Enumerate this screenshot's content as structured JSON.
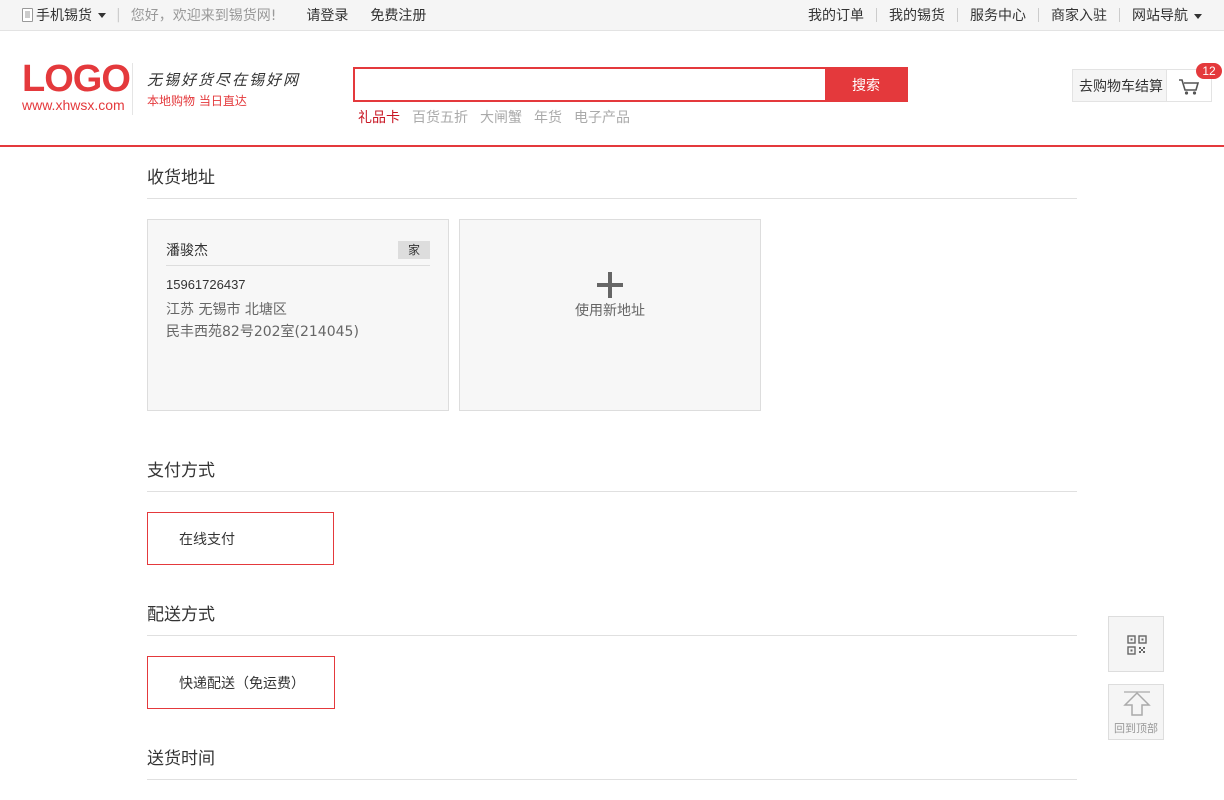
{
  "topbar": {
    "mobile": "手机锡货",
    "welcome": "您好，欢迎来到锡货网!",
    "login": "请登录",
    "register": "免费注册",
    "links": [
      "我的订单",
      "我的锡货",
      "服务中心",
      "商家入驻",
      "网站导航"
    ]
  },
  "header": {
    "logo_text": "LOGO",
    "logo_url": "www.xhwsx.com",
    "slogan": "无锡好货尽在锡好网",
    "slogan_sub": "本地购物  当日直达",
    "search_value": "",
    "search_button": "搜索",
    "hotwords": [
      "礼品卡",
      "百货五折",
      "大闸蟹",
      "年货",
      "电子产品"
    ],
    "cart_label": "去购物车结算",
    "cart_count": "12"
  },
  "address": {
    "title": "收货地址",
    "card": {
      "name": "潘骏杰",
      "tag": "家",
      "phone": "15961726437",
      "region": "江苏 无锡市 北塘区",
      "street": "民丰西苑82号202室(214045)"
    },
    "new_label": "使用新地址"
  },
  "payment": {
    "title": "支付方式",
    "option": "在线支付"
  },
  "delivery": {
    "title": "配送方式",
    "option": "快递配送（免运费）"
  },
  "delivery_time": {
    "title": "送货时间"
  },
  "side": {
    "back_top": "回到顶部"
  },
  "colors": {
    "accent": "#e4393c",
    "border": "#dddddd",
    "card_bg": "#f7f7f7"
  }
}
